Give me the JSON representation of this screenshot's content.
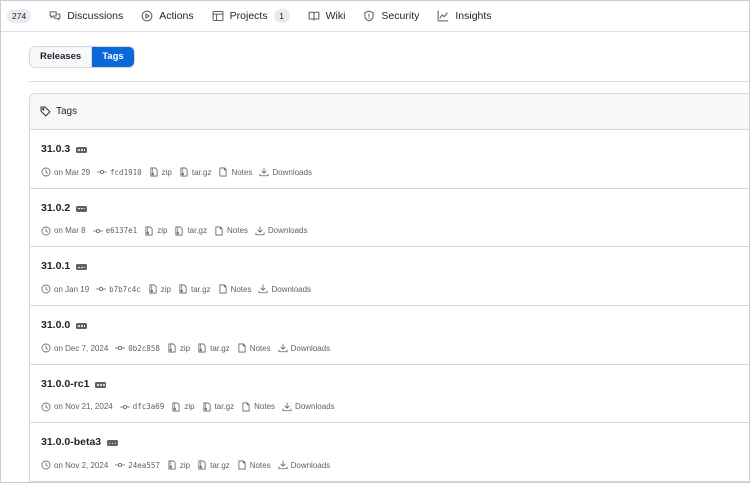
{
  "nav": {
    "first_counter": "274",
    "items": [
      {
        "label": "Discussions",
        "icon": "comment-discussion-icon"
      },
      {
        "label": "Actions",
        "icon": "play-icon"
      },
      {
        "label": "Projects",
        "icon": "table-icon",
        "counter": "1"
      },
      {
        "label": "Wiki",
        "icon": "book-icon"
      },
      {
        "label": "Security",
        "icon": "shield-icon"
      },
      {
        "label": "Insights",
        "icon": "graph-icon"
      }
    ]
  },
  "segmented": {
    "releases_label": "Releases",
    "tags_label": "Tags",
    "active": "Tags"
  },
  "box": {
    "header_label": "Tags"
  },
  "meta_labels": {
    "zip": "zip",
    "targz": "tar.gz",
    "notes": "Notes",
    "downloads": "Downloads"
  },
  "tags": [
    {
      "name": "31.0.3",
      "date": "on Mar 29",
      "commit": "fcd1910"
    },
    {
      "name": "31.0.2",
      "date": "on Mar 8",
      "commit": "e6137e1"
    },
    {
      "name": "31.0.1",
      "date": "on Jan 19",
      "commit": "b7b7c4c"
    },
    {
      "name": "31.0.0",
      "date": "on Dec 7, 2024",
      "commit": "0b2c858"
    },
    {
      "name": "31.0.0-rc1",
      "date": "on Nov 21, 2024",
      "commit": "dfc3a69"
    },
    {
      "name": "31.0.0-beta3",
      "date": "on Nov 2, 2024",
      "commit": "24ea557"
    }
  ],
  "colors": {
    "accent": "#0969da",
    "border": "#d1d9e0",
    "muted": "#59636e"
  }
}
